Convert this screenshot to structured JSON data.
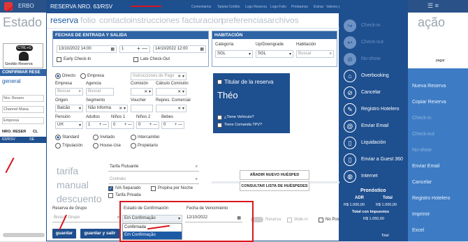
{
  "background": {
    "app_title": "ERBO",
    "page_title": "Estado Re",
    "page_title_right": "ação",
    "gestao_reserva": "Gestão Reserva",
    "confirmar": "CONFIRMAR RESE",
    "general": "general",
    "rows": [
      "Nro. Reserv",
      "Channel Mana",
      "Empresa"
    ],
    "grid_header": "NRO. RESER",
    "grid_col": "CL",
    "grid_row": "63/RSV",
    "grid_row_col": "SE",
    "right_items": [
      "Nueva Reserva",
      "Copiar Reserva",
      "Check-in",
      "Check-out",
      "No-show",
      "Enviar Email",
      "Cancelar",
      "Registro Hotelero",
      "Imprimir",
      "Excel"
    ],
    "ctrl_label": "CTRL+G",
    "pagar": "pagar"
  },
  "modal": {
    "title": "RESERVA NRO. 63/RSV",
    "topnav": [
      "Comentarios",
      "Tarjeta Crédito",
      "Logs Reserva",
      "Logs Folio",
      "Préstamos",
      "Extras",
      "Valores por Noche"
    ],
    "tabs": [
      "reserva",
      "folio",
      "contacto",
      "instrucciones facturacion",
      "preferencias",
      "archivos"
    ]
  },
  "dates": {
    "header": "FECHAS DE ENTRADA Y SALIDA",
    "checkin": "13/10/2022 14:00",
    "nights": "1",
    "checkout": "14/10/2022 12:00",
    "early": "Early Check-In",
    "late": "Late Check-Out"
  },
  "habitacion": {
    "header": "HABITACIÓN",
    "categoria_label": "Categoría",
    "updown_label": "Up/Downgrade",
    "hab_label": "Habitación",
    "categoria": "SGL",
    "updown": "SGL",
    "hab_placeholder": "Buscar"
  },
  "cliente": {
    "directo": "Directo",
    "empresa": "Empresa",
    "instr_placeholder": "Instrucciones de Pago",
    "empresa_label": "Empresa",
    "agencia_label": "Agencia",
    "comision_label": "Comisión",
    "calc_label": "Cálculo Comisión",
    "buscar": "Buscar",
    "origen_label": "Origen",
    "segmento_label": "Segmento",
    "voucher_label": "Voucher",
    "repres_label": "Repres. Comercial",
    "origen": "Balcão",
    "segmento": "Não Informa",
    "pension_label": "Pensión",
    "adultos_label": "Adultos",
    "ninos1_label": "Niños 1",
    "ninos2_label": "Niños 2",
    "bebes_label": "Bebes",
    "pension": "UH",
    "adultos": "1",
    "ninos1": "0",
    "ninos2": "0",
    "bebes": "0",
    "types": [
      "Standard",
      "Invitado",
      "Intercambio",
      "Tripulación",
      "House-Use",
      "Propietario"
    ]
  },
  "titular": {
    "label": "Titular de la reserva",
    "name": "Théo",
    "vehiculo": "¿Tiene Vehículo?",
    "comanda": "Tiene Comanda TPV?"
  },
  "tarifa": {
    "tarifa": "tarifa",
    "manual": "manual",
    "descuento": "descuento",
    "tarifa_value": "Tarifa Flutuante",
    "contrato": "Contrato",
    "iva": "IVA Separado",
    "propina": "Propina por Noche",
    "privada": "Tarifa Privada"
  },
  "buttons": {
    "add_huesped": "AÑADIR NUEVO HUÉSPED",
    "consultar": "CONSULTAR LISTA DE HUÉSPEDES",
    "guardar": "guardar",
    "guardar_salir": "guardar y salir"
  },
  "grupo": {
    "label": "Reserva de Grupo",
    "placeholder": "Buscar Grupo"
  },
  "confirmacion": {
    "label": "Estado de Confirmación",
    "value": "Em Confirmação",
    "options": [
      "Confirmada",
      "Em Confirmação"
    ],
    "venc_label": "Fecha de Vencimiento",
    "venc": "12/10/2022",
    "reserva": "Reserva",
    "walkin": "Walk-in",
    "nopost": "No Post"
  },
  "panel": {
    "items": [
      "Check-in",
      "Check-out",
      "No-show",
      "Overbooking",
      "Cancelar",
      "Registro Hotelero",
      "Enviar Email",
      "Liquidación",
      "Enviar a Guest 360",
      "Internet"
    ],
    "pron_title": "Pronóstico",
    "adr_label": "ADR",
    "total_label": "Total",
    "adr": "R$ 1.000,00",
    "total": "R$ 1.000,00",
    "impuestos_label": "Total con Impuestos",
    "impuestos": "R$ 1.050,00",
    "foot": "Total"
  },
  "colors": {
    "header": "#1e4f8f",
    "accent": "#1d5aa6",
    "highlight": "#d9161d"
  }
}
